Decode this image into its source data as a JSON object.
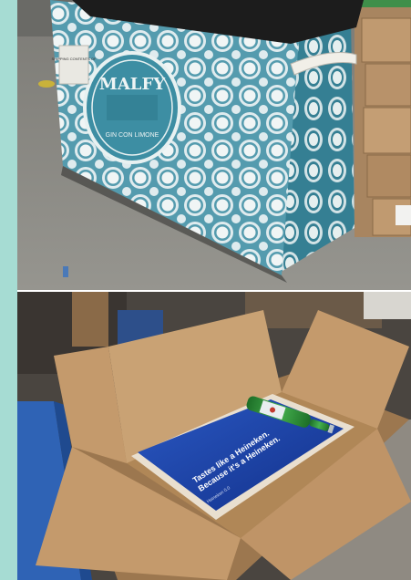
{
  "top_photo": {
    "cooler_wrap_brand": "MALFY",
    "cooler_wrap_tagline": "GIN CON LIMONE",
    "cooler_sticker_text": "SHIPPING CONTENTS OF",
    "colors": {
      "floor": "#8a8a86",
      "teal_pattern": "#3d8ea3",
      "pattern_light": "#dbe9ec",
      "cover": "#1c1c1c",
      "cardboard": "#b8926a"
    }
  },
  "bottom_photo": {
    "poster_headline_line1": "Tastes like a Heineken.",
    "poster_headline_line2": "Because it's a Heineken.",
    "poster_subline": "Heineken 0.0",
    "colors": {
      "box": "#c49a6c",
      "box_shadow": "#9c774f",
      "poster_blue": "#1a3fa6",
      "bottle_green": "#2f9a3a"
    }
  }
}
